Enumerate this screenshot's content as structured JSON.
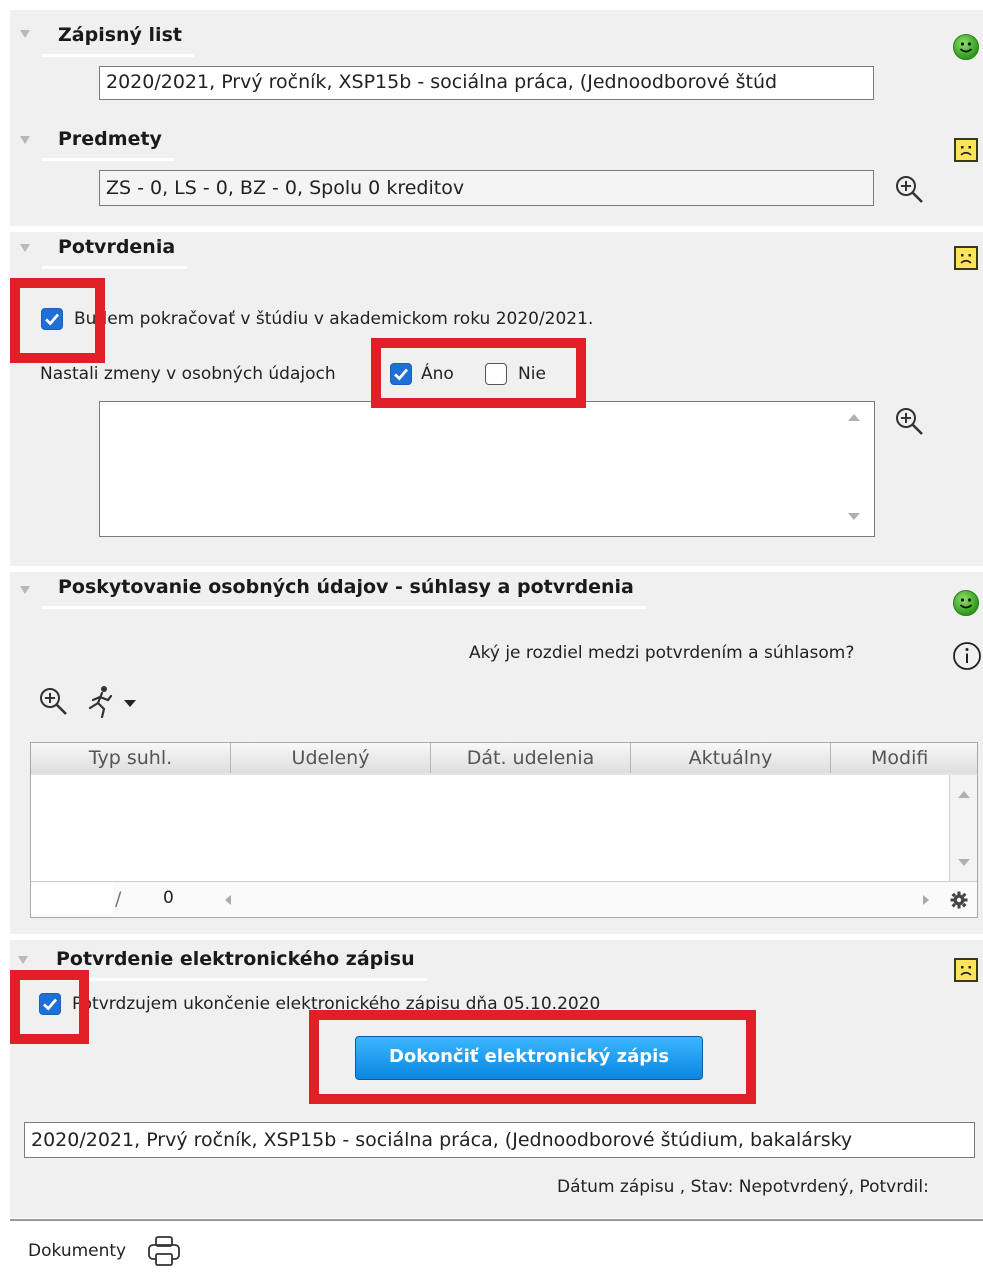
{
  "sections": {
    "zapisny_list": {
      "title": "Zápisný list",
      "value": "2020/2021, Prvý ročník, XSP15b - sociálna práca, (Jednoodborové štúd"
    },
    "predmety": {
      "title": "Predmety",
      "value": "ZS - 0, LS - 0, BZ - 0, Spolu 0 kreditov"
    },
    "potvrdenia": {
      "title": "Potvrdenia",
      "checkbox_label": "Budem pokračovať v štúdiu v akademickom roku 2020/2021.",
      "checkbox_checked": true,
      "zmeny_label": "Nastali zmeny v osobných údajoch",
      "ano_label": "Áno",
      "ano_checked": true,
      "nie_label": "Nie",
      "nie_checked": false,
      "textarea_value": ""
    },
    "poskytovanie": {
      "title": "Poskytovanie osobných údajov - súhlasy a potvrdenia",
      "info_question": "Aký je rozdiel medzi potvrdením a súhlasom?",
      "table": {
        "columns": [
          "Typ suhl.",
          "Udelený",
          "Dát. udelenia",
          "Aktuálny",
          "Modifi"
        ],
        "rows": [],
        "pager_current": "",
        "pager_separator": "/",
        "pager_total": "0"
      }
    },
    "elektronicky_zapis": {
      "title": "Potvrdenie elektronického zápisu",
      "checkbox_label": "Potvrdzujem ukončenie elektronického zápisu dňa 05.10.2020",
      "checkbox_checked": true,
      "button_label": "Dokončiť elektronický zápis",
      "summary_value": "2020/2021, Prvý ročník, XSP15b - sociálna práca, (Jednoodborové štúdium, bakalársky",
      "status_line": "Dátum zápisu , Stav: Nepotvrdený, Potvrdil:"
    }
  },
  "footer": {
    "dokumenty_label": "Dokumenty"
  },
  "icons": {
    "status_ok": "smiley-happy-icon",
    "status_warn": "smiley-sad-icon",
    "zoom": "zoom-in-icon",
    "info": "info-icon",
    "action": "running-man-icon",
    "settings": "gear-icon",
    "print": "printer-icon"
  },
  "colors": {
    "panel_bg": "#f0f0f0",
    "highlight_red": "#e01f26",
    "checkbox_blue": "#1e6fd6",
    "button_blue": "#0a86e0",
    "ok_green": "#2f9a1c",
    "warn_yellow": "#fbe45a"
  }
}
